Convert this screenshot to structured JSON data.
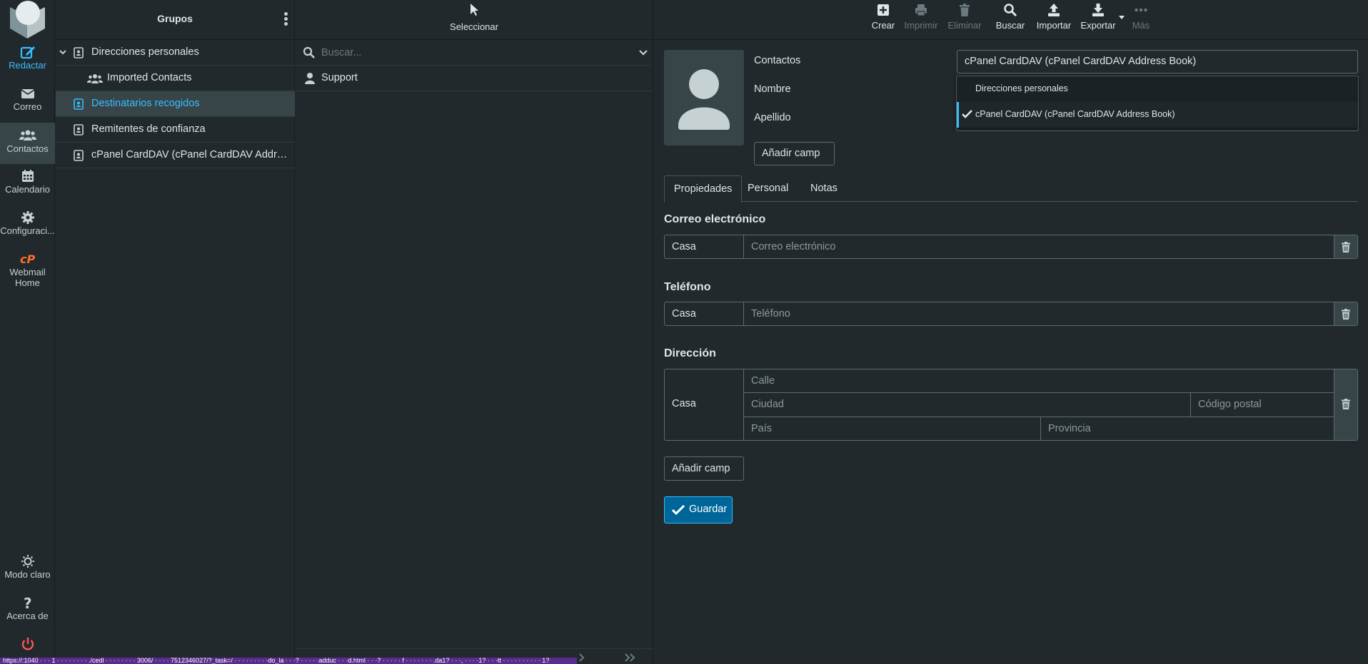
{
  "colors": {
    "accent": "#37beff",
    "background": "#21292c",
    "selected_bg": "#374549",
    "logout": "#ff5552",
    "cpanel": "#ff6c2c",
    "status_bar": "#5a2c8c"
  },
  "taskmenu": {
    "items": [
      {
        "label": "Redactar",
        "icon": "compose-icon"
      },
      {
        "label": "Correo",
        "icon": "mail-icon"
      },
      {
        "label": "Contactos",
        "icon": "contacts-icon"
      },
      {
        "label": "Calendario",
        "icon": "calendar-icon"
      },
      {
        "label": "Configuraci...",
        "icon": "gear-icon"
      },
      {
        "label": "Webmail Home",
        "icon": "cpanel-icon"
      }
    ],
    "bottom": [
      {
        "label": "Modo claro",
        "icon": "sun-icon"
      },
      {
        "label": "Acerca de",
        "icon": "question-icon"
      },
      {
        "label": "",
        "icon": "power-icon"
      }
    ]
  },
  "groups": {
    "title": "Grupos",
    "items": [
      {
        "label": "Direcciones personales",
        "icon": "address-book-icon"
      },
      {
        "label": "Imported Contacts",
        "icon": "group-icon"
      },
      {
        "label": "Destinatarios recogidos",
        "icon": "address-book-icon"
      },
      {
        "label": "Remitentes de confianza",
        "icon": "address-book-icon"
      },
      {
        "label": "cPanel CardDAV (cPanel CardDAV Address Book)",
        "icon": "address-book-icon"
      }
    ]
  },
  "list": {
    "select_label": "Seleccionar",
    "search_placeholder": "Buscar...",
    "contacts": [
      {
        "name": "Support"
      }
    ]
  },
  "toolbar": {
    "create": "Crear",
    "print": "Imprimir",
    "delete": "Eliminar",
    "search": "Buscar",
    "import": "Importar",
    "export": "Exportar",
    "more": "Más"
  },
  "form": {
    "contacts_label": "Contactos",
    "name_label": "Nombre",
    "surname_label": "Apellido",
    "addressbook_value": "cPanel CardDAV (cPanel CardDAV Address Book)",
    "dropdown_options": [
      {
        "label": "Direcciones personales",
        "checked": false
      },
      {
        "label": "cPanel CardDAV (cPanel CardDAV Address Book)",
        "checked": true
      }
    ],
    "add_field_top": "Añadir camp",
    "tabs": [
      "Propiedades",
      "Personal",
      "Notas"
    ],
    "email_section": "Correo electrónico",
    "email_type": "Casa",
    "email_placeholder": "Correo electrónico",
    "phone_section": "Teléfono",
    "phone_type": "Casa",
    "phone_placeholder": "Teléfono",
    "address_section": "Dirección",
    "address_type": "Casa",
    "street_placeholder": "Calle",
    "city_placeholder": "Ciudad",
    "postcode_placeholder": "Código postal",
    "country_placeholder": "País",
    "province_placeholder": "Provincia",
    "add_field_bottom": "Añadir camp",
    "save": "Guardar"
  },
  "statusbar": {
    "url": "https://:1040 · · · 1 · · · · · · · · ./cedl · · · · · · · · 3006/ · · · · 7512346027/?_task=/ · · · · · · · · ·do_la · · ·? · · · · ·adduc · · ·d.html · · ·? · · · · · f · · · · · · · .da1? · · ·, · · · ·1? · · ·tt · · · · · · · · · · 1?"
  }
}
